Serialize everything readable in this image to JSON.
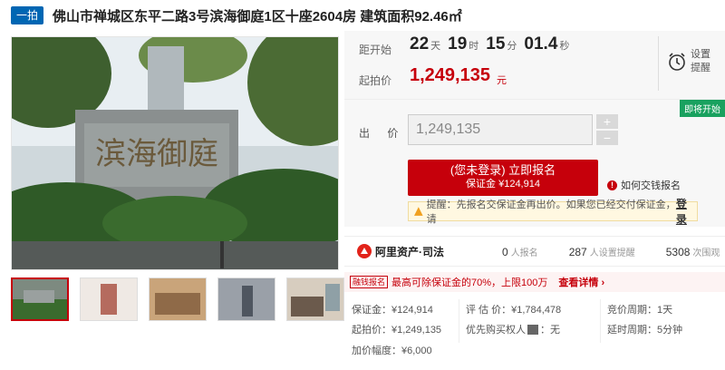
{
  "header": {
    "tag": "一拍",
    "title": "佛山市禅城区东平二路3号滨海御庭1区十座2604房 建筑面积92.46㎡"
  },
  "countdown": {
    "label": "距开始",
    "days": "22",
    "days_unit": "天",
    "hours": "19",
    "hours_unit": "时",
    "minutes": "15",
    "minutes_unit": "分",
    "seconds": "01.4",
    "seconds_unit": "秒",
    "start_price_label": "起拍价",
    "start_price": "1,249,135",
    "start_price_unit": "元",
    "remind_label": "设置提醒",
    "remind_icon": "alarm-clock-icon"
  },
  "bid": {
    "status_badge": "即将开始",
    "label": "出 价",
    "value": "1,249,135",
    "plus": "+",
    "minus": "−",
    "register_main": "(您未登录) 立即报名",
    "register_sub": "保证金 ¥124,914",
    "how_pay": "如何交钱报名",
    "notice_text": "提醒：先报名交保证金再出价。如果您已经交付保证金，请",
    "notice_link": "登录"
  },
  "stats": {
    "brand": "阿里资产·司法",
    "registrants_num": "0",
    "registrants_unit": "人报名",
    "reminders_num": "287",
    "reminders_unit": "人设置提醒",
    "views_num": "5308",
    "views_unit": "次围观"
  },
  "loan": {
    "tag": "融钱报名",
    "text": "最高可除保证金的70%，上限100万",
    "link": "查看详情 ›"
  },
  "info": {
    "deposit": "保证金：¥124,914",
    "start_price": "起拍价：¥1,249,135",
    "increment": "加价幅度：¥6,000",
    "appraisal": "评 估 价：¥1,784,478",
    "priority_label": "优先购买权人",
    "priority_value": "：无",
    "bid_cycle": "竞价周期：1天",
    "delay_cycle": "延时周期：5分钟"
  },
  "colors": {
    "brand_red": "#c6000b",
    "tag_blue": "#0066b3",
    "badge_green": "#19a15f"
  }
}
